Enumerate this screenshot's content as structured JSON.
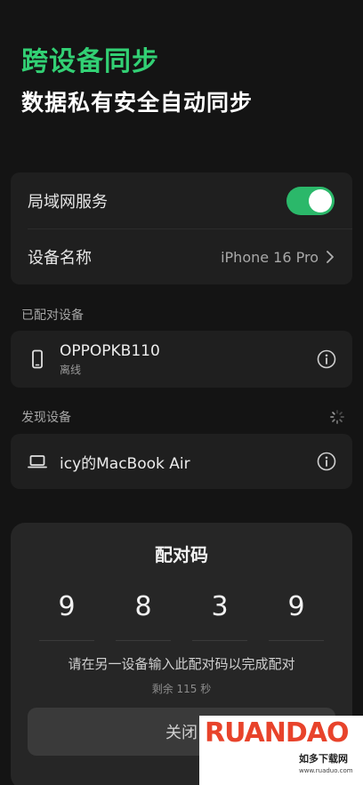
{
  "header": {
    "title": "跨设备同步",
    "subtitle": "数据私有安全自动同步"
  },
  "settings": {
    "lan_service_label": "局域网服务",
    "lan_service_enabled": true,
    "device_name_label": "设备名称",
    "device_name_value": "iPhone 16 Pro"
  },
  "paired": {
    "section_label": "已配对设备",
    "devices": [
      {
        "name": "OPPOPKB110",
        "status": "离线",
        "icon": "phone-icon"
      }
    ]
  },
  "discovered": {
    "section_label": "发现设备",
    "devices": [
      {
        "name": "icy的MacBook Air",
        "icon": "laptop-icon"
      }
    ]
  },
  "pairing_sheet": {
    "title": "配对码",
    "digits": [
      "9",
      "8",
      "3",
      "9"
    ],
    "instruction": "请在另一设备输入此配对码以完成配对",
    "countdown": "剩余 115 秒",
    "close_label": "关闭"
  },
  "watermark": {
    "logo": "RUANDAO",
    "site_name": "如多下载网",
    "url": "www.ruaduo.com"
  },
  "colors": {
    "accent": "#32d074",
    "toggle_on": "#2bb86a",
    "background": "#141414",
    "card": "#1f1f1f"
  }
}
